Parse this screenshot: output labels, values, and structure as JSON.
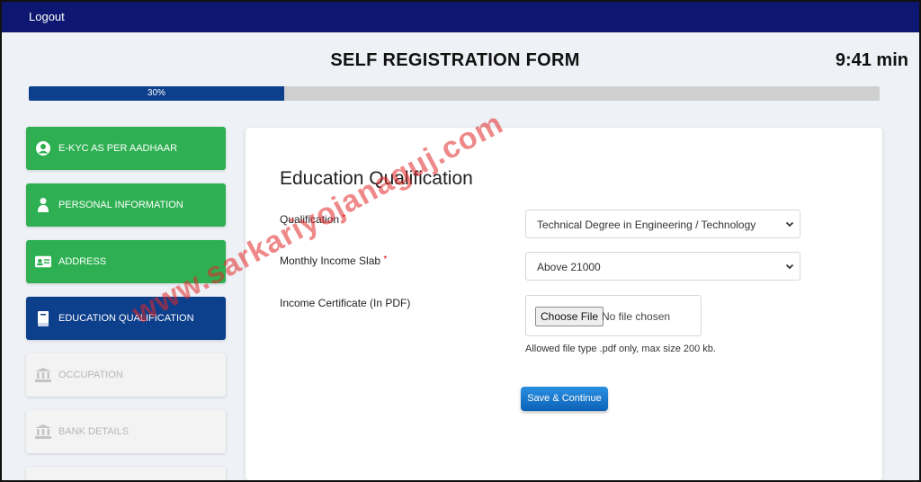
{
  "topbar": {
    "logout_label": "Logout"
  },
  "header": {
    "title": "SELF REGISTRATION FORM",
    "timer": "9:41 min"
  },
  "progress": {
    "value_percent": 30,
    "label": "30%"
  },
  "sidebar": {
    "items": [
      {
        "label": "E-KYC AS PER AADHAAR",
        "state": "done",
        "icon": "user-circle-icon"
      },
      {
        "label": "PERSONAL INFORMATION",
        "state": "done",
        "icon": "person-icon"
      },
      {
        "label": "ADDRESS",
        "state": "done",
        "icon": "id-card-icon"
      },
      {
        "label": "EDUCATION QUALIFICATION",
        "state": "active",
        "icon": "book-icon"
      },
      {
        "label": "OCCUPATION",
        "state": "pending",
        "icon": "bank-icon"
      },
      {
        "label": "BANK DETAILS",
        "state": "pending",
        "icon": "bank-icon"
      }
    ]
  },
  "form": {
    "section_title": "Education Qualification",
    "qualification": {
      "label": "Qualification",
      "required_mark": "*",
      "value": "Technical Degree in Engineering / Technology"
    },
    "income_slab": {
      "label": "Monthly Income Slab",
      "required_mark": "*",
      "value": "Above 21000"
    },
    "income_certificate": {
      "label": "Income Certificate (In PDF)",
      "choose_label": "Choose File",
      "no_file_text": "No file chosen",
      "hint": "Allowed file type .pdf only, max size 200 kb."
    },
    "save_label": "Save & Continue"
  },
  "watermark": "www.sarkariyojanaguj.com",
  "colors": {
    "topbar": "#0d1670",
    "done": "#2eb052",
    "active": "#0c3f8c",
    "pending": "#f3f3f3",
    "progress_fill": "#0c3f8c",
    "save_button": "#0d62b8"
  }
}
